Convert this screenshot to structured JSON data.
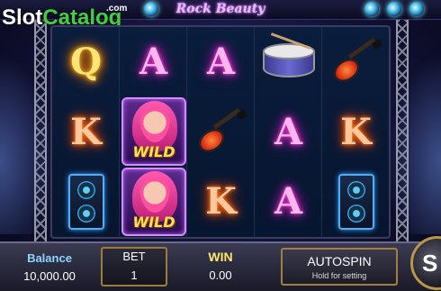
{
  "watermark": {
    "brand_left": "Slot",
    "brand_right": "Catalog",
    "suffix": ".com"
  },
  "game": {
    "title": "Rock Beauty"
  },
  "reels": [
    [
      "Q",
      "K",
      "speaker"
    ],
    [
      "A",
      "WILD",
      "WILD"
    ],
    [
      "A",
      "guitar",
      "K"
    ],
    [
      "drum",
      "A",
      "A"
    ],
    [
      "guitar",
      "K",
      "speaker"
    ]
  ],
  "symbols": {
    "wild_label": "WILD"
  },
  "footer": {
    "balance_label": "Balance",
    "balance_value": "10,000.00",
    "bet_label": "BET",
    "bet_value": "1",
    "win_label": "WIN",
    "win_value": "0.00",
    "autospin_label": "AUTOSPIN",
    "autospin_sub": "Hold for setting",
    "spin_label": "S"
  },
  "colors": {
    "q": "#ffe47a",
    "a": "#ffb5ee",
    "k": "#ffc79a",
    "wild": "#ffe054"
  }
}
